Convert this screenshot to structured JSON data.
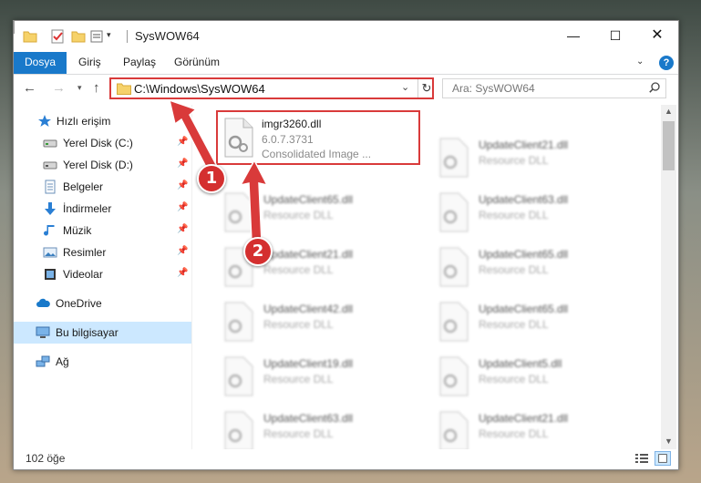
{
  "window": {
    "title": "SysWOW64",
    "controls": {
      "minimize": "—",
      "maximize": "☐",
      "close": "✕"
    }
  },
  "ribbon": {
    "tabs": [
      "Dosya",
      "Giriş",
      "Paylaş",
      "Görünüm"
    ],
    "help": "?"
  },
  "navigation": {
    "address": "C:\\Windows\\SysWOW64",
    "search_placeholder": "Ara: SysWOW64"
  },
  "sidebar": {
    "items": [
      {
        "label": "Hızlı erişim",
        "icon": "star-icon",
        "pinned": false
      },
      {
        "label": "Yerel Disk (C:)",
        "icon": "drive-icon",
        "pinned": true
      },
      {
        "label": "Yerel Disk (D:)",
        "icon": "drive-icon",
        "pinned": true
      },
      {
        "label": "Belgeler",
        "icon": "documents-icon",
        "pinned": true
      },
      {
        "label": "İndirmeler",
        "icon": "download-icon",
        "pinned": true
      },
      {
        "label": "Müzik",
        "icon": "music-icon",
        "pinned": true
      },
      {
        "label": "Resimler",
        "icon": "pictures-icon",
        "pinned": true
      },
      {
        "label": "Videolar",
        "icon": "videos-icon",
        "pinned": true
      },
      {
        "label": "OneDrive",
        "icon": "cloud-icon",
        "pinned": false
      },
      {
        "label": "Bu bilgisayar",
        "icon": "computer-icon",
        "pinned": false,
        "selected": true
      },
      {
        "label": "Ağ",
        "icon": "network-icon",
        "pinned": false
      }
    ]
  },
  "files": [
    {
      "name": "imgr3260.dll",
      "version": "6.0.7.3731",
      "description": "Consolidated Image ...",
      "highlighted": true
    },
    {
      "name": "UpdateClient21.dll",
      "type": "Resource DLL"
    },
    {
      "name": "UpdateClient65.dll",
      "type": "Resource DLL"
    },
    {
      "name": "UpdateClient63.dll",
      "type": "Resource DLL"
    },
    {
      "name": "UpdateClient21.dll",
      "type": "Resource DLL"
    },
    {
      "name": "UpdateClient65.dll",
      "type": "Resource DLL"
    },
    {
      "name": "UpdateClient42.dll",
      "type": "Resource DLL"
    },
    {
      "name": "UpdateClient65.dll",
      "type": "Resource DLL"
    },
    {
      "name": "UpdateClient19.dll",
      "type": "Resource DLL"
    },
    {
      "name": "UpdateClient5.dll",
      "type": "Resource DLL"
    },
    {
      "name": "UpdateClient63.dll",
      "type": "Resource DLL"
    },
    {
      "name": "UpdateClient21.dll",
      "type": "Resource DLL"
    }
  ],
  "status": {
    "item_count": "102 öğe"
  },
  "annotations": {
    "step1": "1",
    "step2": "2",
    "color": "#d93a3a"
  }
}
